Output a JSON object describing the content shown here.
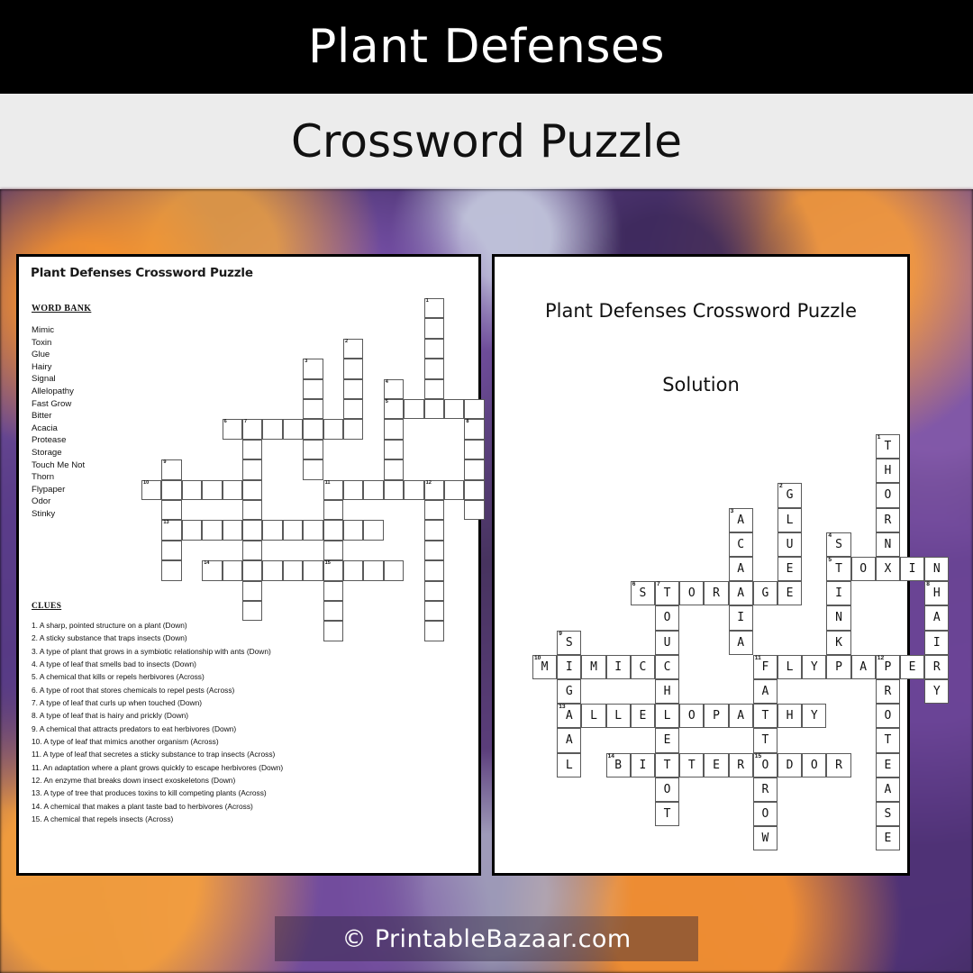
{
  "header": {
    "title": "Plant Defenses",
    "subtitle": "Crossword Puzzle"
  },
  "left_sheet": {
    "title": "Plant Defenses Crossword Puzzle",
    "word_bank_heading": "WORD BANK",
    "word_bank": [
      "Mimic",
      "Toxin",
      "Glue",
      "Hairy",
      "Signal",
      "Allelopathy",
      "Fast Grow",
      "Bitter",
      "Acacia",
      "Protease",
      "Storage",
      "Touch Me Not",
      "Thorn",
      "Flypaper",
      "Odor",
      "Stinky"
    ],
    "clues_heading": "CLUES",
    "clues": [
      "1. A sharp, pointed structure on a plant (Down)",
      "2. A sticky substance that traps insects (Down)",
      "3. A type of plant that grows in a symbiotic relationship with ants (Down)",
      "4. A type of leaf that smells bad to insects (Down)",
      "5. A chemical that kills or repels herbivores (Across)",
      "6. A type of root that stores chemicals to repel pests (Across)",
      "7. A type of leaf that curls up when touched (Down)",
      "8. A type of leaf that is hairy and prickly (Down)",
      "9. A chemical that attracts predators to eat herbivores (Down)",
      "10. A type of leaf that mimics another organism (Across)",
      "11. A type of leaf that secretes a sticky substance to trap insects (Across)",
      "11. An adaptation where a plant grows quickly to escape herbivores (Down)",
      "12. An enzyme that breaks down insect exoskeletons (Down)",
      "13. A type of tree that produces toxins to kill competing plants (Across)",
      "14. A chemical that makes a plant taste bad to herbivores (Across)",
      "15. A chemical that repels insects (Across)"
    ]
  },
  "right_sheet": {
    "title": "Plant Defenses Crossword Puzzle",
    "subtitle": "Solution"
  },
  "footer": {
    "watermark": "© PrintableBazaar.com"
  },
  "colors": {
    "header_bg": "#000000",
    "subheader_bg": "#ececec",
    "sheet_bg": "#ffffff",
    "sheet_border": "#000000",
    "cell_border": "#5a5a5a",
    "text": "#111111"
  },
  "crossword": {
    "cols": 17,
    "rows": 15,
    "entries": [
      {
        "number": 1,
        "answer": "THORN",
        "direction": "Down",
        "col": 14,
        "row": 0
      },
      {
        "number": 2,
        "answer": "GLUE",
        "direction": "Down",
        "col": 10,
        "row": 2
      },
      {
        "number": 3,
        "answer": "ACACIA",
        "direction": "Down",
        "col": 8,
        "row": 3
      },
      {
        "number": 4,
        "answer": "STINKY",
        "direction": "Down",
        "col": 12,
        "row": 4
      },
      {
        "number": 5,
        "answer": "TOXIN",
        "direction": "Across",
        "col": 12,
        "row": 5
      },
      {
        "number": 6,
        "answer": "STORAGE",
        "direction": "Across",
        "col": 4,
        "row": 6
      },
      {
        "number": 7,
        "answer": "TOUCHMENOT",
        "direction": "Down",
        "col": 5,
        "row": 6
      },
      {
        "number": 8,
        "answer": "HAIRY",
        "direction": "Down",
        "col": 16,
        "row": 6
      },
      {
        "number": 9,
        "answer": "SIGNAL",
        "direction": "Down",
        "col": 1,
        "row": 8
      },
      {
        "number": 10,
        "answer": "MIMIC",
        "direction": "Across",
        "col": 0,
        "row": 9
      },
      {
        "number": 11,
        "answer": "FLYPAPER",
        "direction": "Across",
        "col": 9,
        "row": 9
      },
      {
        "number": 11,
        "answer": "FASTGROW",
        "direction": "Down",
        "col": 9,
        "row": 9
      },
      {
        "number": 12,
        "answer": "PROTEASE",
        "direction": "Down",
        "col": 14,
        "row": 9
      },
      {
        "number": 13,
        "answer": "ALLELOPATHY",
        "direction": "Across",
        "col": 1,
        "row": 11
      },
      {
        "number": 14,
        "answer": "BITTER",
        "direction": "Across",
        "col": 3,
        "row": 13
      },
      {
        "number": 15,
        "answer": "ODOR",
        "direction": "Across",
        "col": 9,
        "row": 13
      }
    ]
  }
}
